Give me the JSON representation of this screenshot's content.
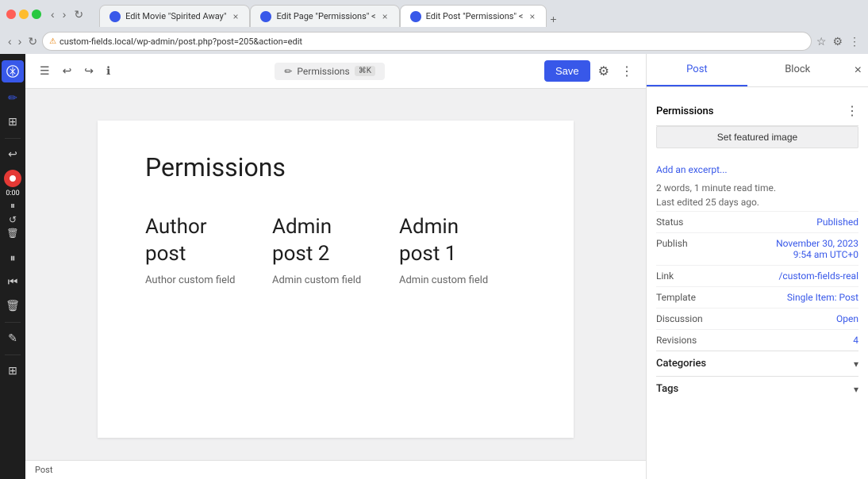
{
  "browser": {
    "tabs": [
      {
        "id": "tab1",
        "title": "Edit Movie \"Spirited Away\"",
        "favicon": "wp",
        "active": false,
        "closeable": true
      },
      {
        "id": "tab2",
        "title": "Edit Page \"Permissions\" <",
        "favicon": "wp",
        "active": false,
        "closeable": true
      },
      {
        "id": "tab3",
        "title": "Edit Post \"Permissions\" <",
        "favicon": "wp",
        "active": true,
        "closeable": true
      }
    ],
    "address": "Not Secure",
    "url": "custom-fields.local/wp-admin/post.php?post=205&action=edit",
    "security_icon": "⚠"
  },
  "editor": {
    "toolbar": {
      "undo_label": "↩",
      "redo_label": "↪",
      "tools_label": "⚙",
      "doc_title": "Permissions",
      "doc_icon": "✏",
      "save_label": "Save",
      "settings_label": "⚙"
    },
    "page": {
      "title": "Permissions",
      "columns": [
        {
          "heading_line1": "Author",
          "heading_line2": "post",
          "subtext": "Author custom field"
        },
        {
          "heading_line1": "Admin",
          "heading_line2": "post 2",
          "subtext": "Admin custom field"
        },
        {
          "heading_line1": "Admin",
          "heading_line2": "post 1",
          "subtext": "Admin custom field"
        }
      ]
    }
  },
  "sidebar": {
    "tabs": [
      {
        "id": "post",
        "label": "Post",
        "active": true
      },
      {
        "id": "block",
        "label": "Block",
        "active": false
      }
    ],
    "permissions_section": {
      "label": "Permissions",
      "menu_icon": "⋮"
    },
    "featured_image_btn": "Set featured image",
    "add_excerpt_link": "Add an excerpt...",
    "word_count_text": "2 words, 1 minute read time.",
    "last_edited_text": "Last edited 25 days ago.",
    "meta_rows": [
      {
        "label": "Status",
        "value": "Published",
        "link": true
      },
      {
        "label": "Publish",
        "value": "November 30, 2023\n9:54 am UTC+0",
        "link": true
      },
      {
        "label": "Link",
        "value": "/custom-fields-real",
        "link": true
      },
      {
        "label": "Template",
        "value": "Single Item: Post",
        "link": true
      },
      {
        "label": "Discussion",
        "value": "Open",
        "link": true
      },
      {
        "label": "Revisions",
        "value": "4",
        "link": true
      }
    ],
    "categories_label": "Categories",
    "tags_label": "Tags"
  },
  "status_bar": {
    "text": "Post"
  },
  "recording": {
    "time": "0:00"
  }
}
